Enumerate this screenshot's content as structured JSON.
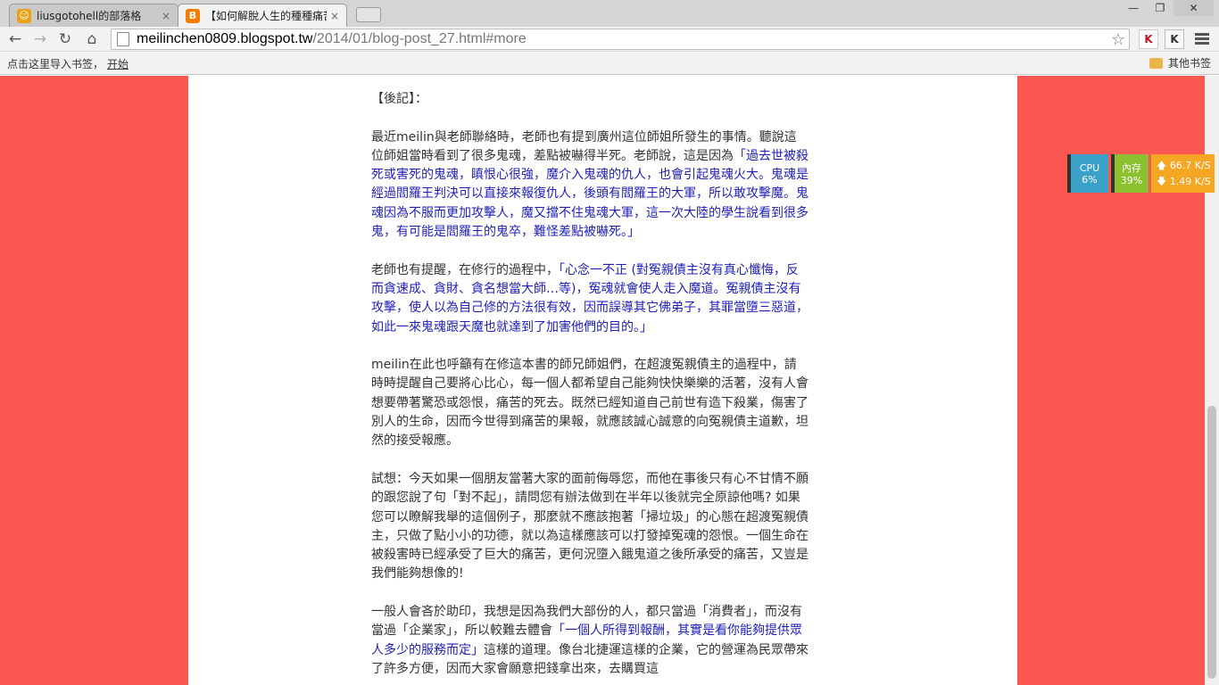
{
  "tabs": [
    {
      "title": "liusgotohell的部落格",
      "close": "×"
    },
    {
      "title": "【如何解脫人生的種種痛苦",
      "close": "×"
    }
  ],
  "window_controls": {
    "minimize": "—",
    "maximize": "❐",
    "close": "✕"
  },
  "toolbar": {
    "url_host": "meilinchen0809.blogspot.tw",
    "url_path": "/2014/01/blog-post_27.html#more",
    "extensions": [
      {
        "name": "red-extension",
        "label": "K"
      },
      {
        "name": "k-extension",
        "label": "K"
      }
    ]
  },
  "bookmarks_bar": {
    "hint": "点击这里导入书签，",
    "start_link": "开始",
    "other": "其他书签"
  },
  "article": {
    "paragraphs": [
      {
        "parts": [
          {
            "text": "【後記】：",
            "blue": false
          }
        ]
      },
      {
        "parts": [
          {
            "text": "最近meilin與老師聯絡時，老師也有提到廣州這位師姐所發生的事情。聽說這位師姐當時看到了很多鬼魂，差點被嚇得半死。老師說，這是因為",
            "blue": false
          },
          {
            "text": "「過去世被殺死或害死的鬼魂，瞋恨心很強，魔介入鬼魂的仇人，也會引起鬼魂火大。鬼魂是經過閻羅王判決可以直接來報復仇人，後頭有閻羅王的大軍，所以敢攻擊魔。鬼魂因為不服而更加攻擊人，魔又擋不住鬼魂大軍，這一次大陸的學生說看到很多鬼，有可能是閻羅王的鬼卒，難怪差點被嚇死。」",
            "blue": true
          }
        ]
      },
      {
        "parts": [
          {
            "text": "老師也有提醒，在修行的過程中，",
            "blue": false
          },
          {
            "text": "「心念一不正 (對冤親債主沒有真心懺悔，反而貪速成、貪財、貪名想當大師…等)，冤魂就會使人走入魔道。冤親債主沒有攻擊，使人以為自己修的方法很有效，因而誤導其它佛弟子，其罪當墮三惡道，如此一來鬼魂跟天魔也就達到了加害他們的目的。」",
            "blue": true
          }
        ]
      },
      {
        "parts": [
          {
            "text": "meilin在此也呼籲有在修這本書的師兄師姐們，在超渡冤親債主的過程中，請時時提醒自己要將心比心，每一個人都希望自己能夠快快樂樂的活著，沒有人會想要帶著驚恐或怨恨，痛苦的死去。既然已經知道自己前世有造下殺業，傷害了別人的生命，因而今世得到痛苦的果報，就應該誠心誠意的向冤親債主道歉，坦然的接受報應。",
            "blue": false
          }
        ]
      },
      {
        "parts": [
          {
            "text": "試想：今天如果一個朋友當著大家的面前侮辱您，而他在事後只有心不甘情不願的跟您說了句「對不起」，請問您有辦法做到在半年以後就完全原諒他嗎? 如果您可以瞭解我舉的這個例子，那麼就不應該抱著「掃垃圾」的心態在超渡冤親債主，只做了點小小的功德，就以為這樣應該可以打發掉冤魂的怨恨。一個生命在被殺害時已經承受了巨大的痛苦，更何況墮入餓鬼道之後所承受的痛苦，又豈是我們能夠想像的!",
            "blue": false
          }
        ]
      },
      {
        "parts": [
          {
            "text": "一般人會吝於助印，我想是因為我們大部份的人，都只當過「消費者」，而沒有當過「企業家」，所以較難去體會",
            "blue": false
          },
          {
            "text": "「一個人所得到報酬，其實是看你能夠提供眾人多少的服務而定」",
            "blue": true
          },
          {
            "text": "這樣的道理。像台北捷運這樣的企業，它的營運為民眾帶來了許多方便，因而大家會願意把錢拿出來，去購買這",
            "blue": false
          }
        ]
      }
    ]
  },
  "monitor": {
    "cpu_label": "CPU",
    "cpu_value": "6%",
    "mem_label": "內存",
    "mem_value": "39%",
    "upload": "66.7 K/S",
    "download": "1.49 K/S"
  },
  "colors": {
    "page_background": "#fb5852",
    "quote_text": "#1f1fb4",
    "body_text": "#333333"
  }
}
